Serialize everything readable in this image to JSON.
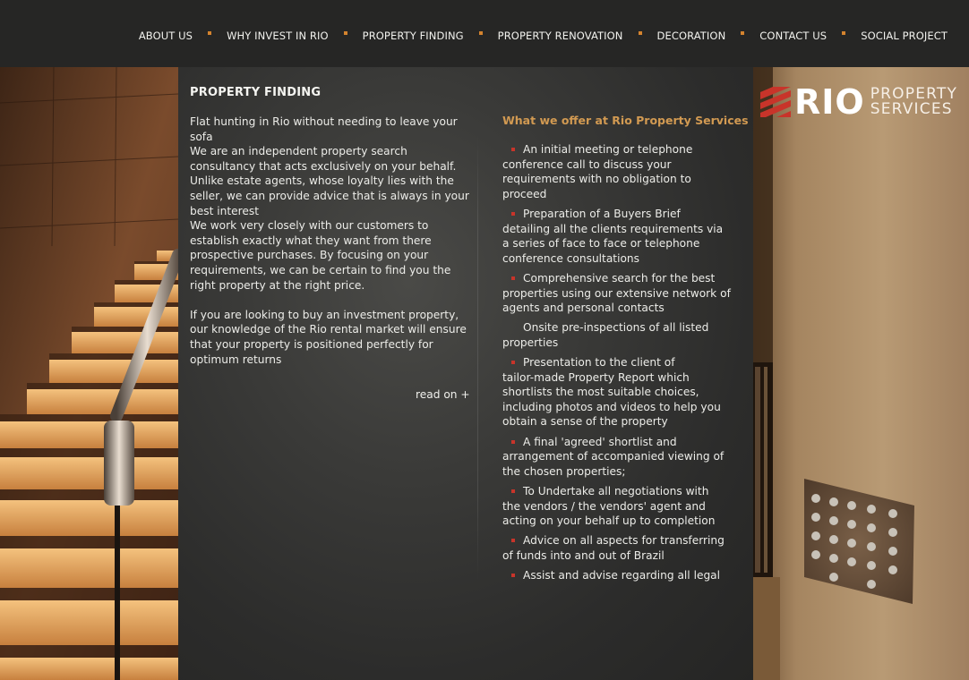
{
  "nav": {
    "items": [
      "ABOUT US",
      "WHY INVEST IN RIO",
      "PROPERTY FINDING",
      "PROPERTY RENOVATION",
      "DECORATION",
      "CONTACT US",
      "SOCIAL PROJECT"
    ]
  },
  "logo": {
    "main": "RIO",
    "line1": "PROPERTY",
    "line2": "SERVICES"
  },
  "main": {
    "title": "PROPERTY FINDING",
    "intro_lines": [
      "Flat hunting in Rio without needing to leave your",
      "sofa",
      "We are an independent property search",
      "consultancy that acts exclusively on your behalf.",
      "Unlike estate agents, whose loyalty lies with the",
      "seller, we can provide advice that is always in your",
      "best interest",
      "We work very closely with our customers to",
      "establish exactly what they want from there",
      "prospective purchases.  By focusing on your",
      "requirements, we can be certain to find you the",
      "right property at the right price.",
      "",
      "If you are looking to buy an investment property,",
      "our knowledge of the Rio rental market will ensure",
      "that your property is positioned perfectly for",
      "optimum returns"
    ],
    "read_on": "read on +"
  },
  "offer": {
    "title": "What we offer at Rio Property Services",
    "items": [
      {
        "first": "An initial meeting or telephone",
        "rest": [
          "conference call to discuss your",
          "requirements with no obligation to",
          "proceed"
        ],
        "bullet": true
      },
      {
        "first": "Preparation of a Buyers Brief",
        "rest": [
          "detailing all the clients requirements via",
          "a series of face to face or telephone",
          "conference consultations"
        ],
        "bullet": true
      },
      {
        "first": "Comprehensive search for the best",
        "rest": [
          "properties using our extensive network of",
          "agents and personal contacts"
        ],
        "bullet": true
      },
      {
        "first": "Onsite pre-inspections of all listed",
        "rest": [
          "properties"
        ],
        "bullet": false
      },
      {
        "first": "Presentation to the client of",
        "rest": [
          "tailor-made Property Report which",
          "shortlists the most suitable choices,",
          "including photos and videos to help you",
          "obtain a sense of the property"
        ],
        "bullet": true
      },
      {
        "first": "A final 'agreed' shortlist and",
        "rest": [
          "arrangement of accompanied viewing of",
          "the chosen properties;"
        ],
        "bullet": true
      },
      {
        "first": "To Undertake all negotiations with",
        "rest": [
          "the vendors / the vendors' agent and",
          "acting on your behalf up to completion"
        ],
        "bullet": true
      },
      {
        "first": "Advice on all aspects for transferring",
        "rest": [
          "of funds into and out of Brazil"
        ],
        "bullet": true
      },
      {
        "first": "Assist and advise regarding all legal",
        "rest": [],
        "bullet": true
      }
    ]
  },
  "colors": {
    "nav_separator": "#d4832e",
    "offer_title": "#d29a52",
    "bullet": "#c8342a",
    "logo_mark": "#c8342a"
  }
}
